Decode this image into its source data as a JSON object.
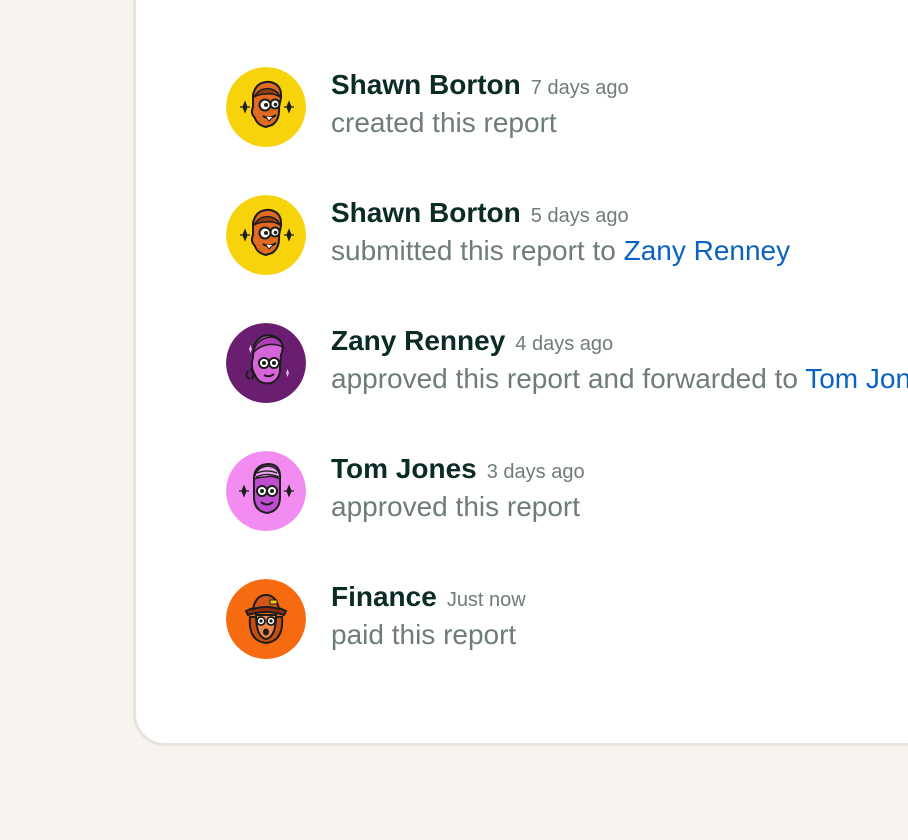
{
  "colors": {
    "page_bg": "#f7f4ef",
    "card_bg": "#ffffff",
    "name_text": "#0b2c25",
    "muted_text": "#6f7c77",
    "link": "#0a62c4"
  },
  "activity": [
    {
      "avatar_icon": "yellow-avatar-icon",
      "avatar_color": "#f6d30b",
      "name": "Shawn Borton",
      "time": "7 days ago",
      "action": "created this report",
      "link": ""
    },
    {
      "avatar_icon": "yellow-avatar-icon",
      "avatar_color": "#f6d30b",
      "name": "Shawn Borton",
      "time": "5 days ago",
      "action": "submitted this report to",
      "link": "Zany Renney"
    },
    {
      "avatar_icon": "purple-avatar-icon",
      "avatar_color": "#6a1e70",
      "name": "Zany Renney",
      "time": "4 days ago",
      "action": "approved this report and forwarded to",
      "link": "Tom Jones"
    },
    {
      "avatar_icon": "pink-avatar-icon",
      "avatar_color": "#f28cf0",
      "name": "Tom Jones",
      "time": "3 days ago",
      "action": "approved this report",
      "link": ""
    },
    {
      "avatar_icon": "orange-avatar-icon",
      "avatar_color": "#f76b10",
      "name": "Finance",
      "time": "Just now",
      "action": "paid this report",
      "link": ""
    }
  ]
}
